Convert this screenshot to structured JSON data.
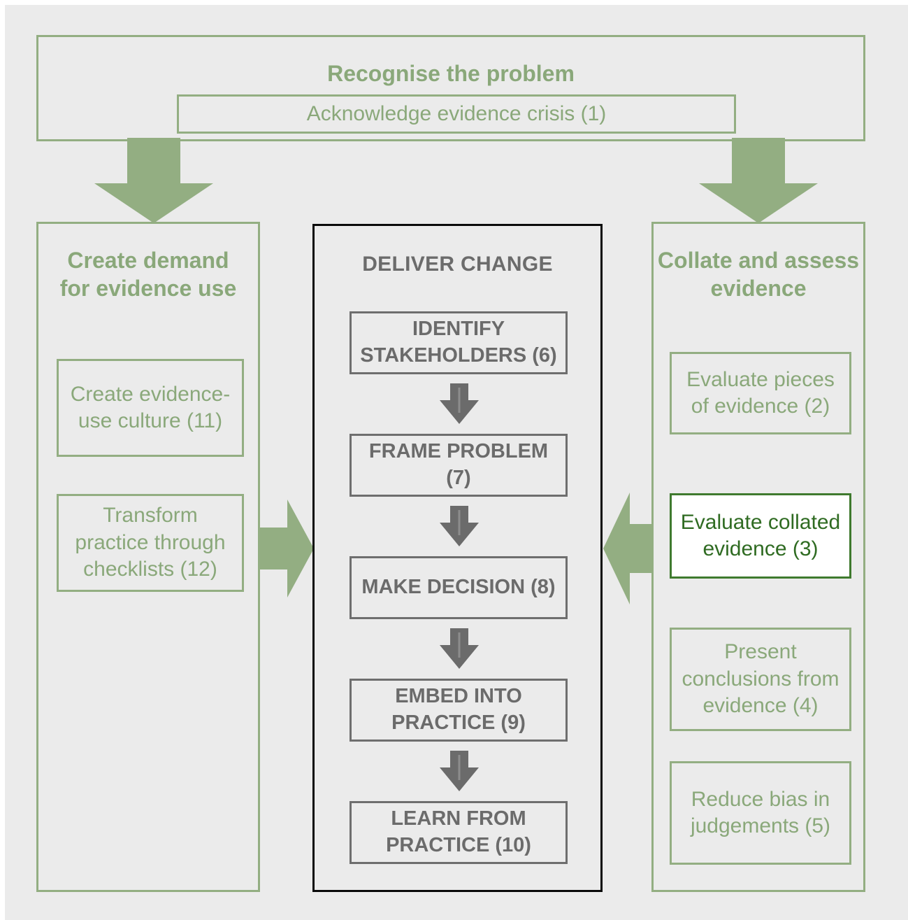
{
  "colors": {
    "background": "#ebebeb",
    "green": "#93ae82",
    "green_text": "#8aa87a",
    "highlight_border": "#3f7a2e",
    "highlight_text": "#2f6b22",
    "gray_box": "#6e6e6e",
    "gray_text": "#6b6b6b",
    "arrow_gray": "#6b6b6b",
    "arrow_gray_highlight": "#8d8d8d",
    "black": "#0a0a0a"
  },
  "top_panel": {
    "title": "Recognise the problem",
    "item": "Acknowledge evidence crisis (1)"
  },
  "left_panel": {
    "title_line1": "Create demand",
    "title_line2": "for evidence use",
    "items": [
      {
        "text": "Create evidence-use culture (11)"
      },
      {
        "text": "Transform practice through checklists (12)"
      }
    ]
  },
  "center_panel": {
    "title": "DELIVER CHANGE",
    "steps": [
      {
        "text": "IDENTIFY STAKEHOLDERS (6)"
      },
      {
        "text": "FRAME PROBLEM (7)"
      },
      {
        "text": "MAKE DECISION (8)"
      },
      {
        "text": "EMBED INTO PRACTICE (9)"
      },
      {
        "text": "LEARN FROM PRACTICE (10)"
      }
    ]
  },
  "right_panel": {
    "title_line1": "Collate and assess",
    "title_line2": "evidence",
    "items": [
      {
        "text": "Evaluate pieces of evidence (2)",
        "highlighted": false
      },
      {
        "text": "Evaluate collated evidence (3)",
        "highlighted": true
      },
      {
        "text": "Present conclusions from evidence (4)",
        "highlighted": false
      },
      {
        "text": "Reduce bias in judgements (5)",
        "highlighted": false
      }
    ]
  },
  "arrows": {
    "top_left_down": "down-arrow",
    "top_right_down": "down-arrow",
    "left_to_center": "right-arrow",
    "right_to_center": "left-arrow",
    "step_connectors": [
      "down-arrow",
      "down-arrow",
      "down-arrow",
      "down-arrow"
    ]
  }
}
